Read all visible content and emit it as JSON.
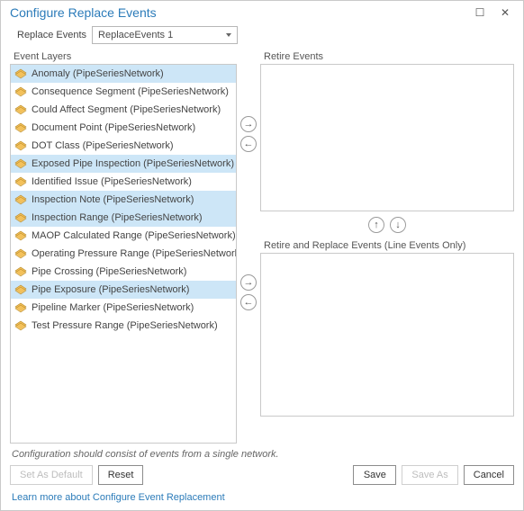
{
  "window": {
    "title": "Configure Replace Events"
  },
  "replaceEvents": {
    "label": "Replace Events",
    "selected": "ReplaceEvents 1"
  },
  "eventLayers": {
    "label": "Event Layers",
    "items": [
      {
        "label": "Anomaly (PipeSeriesNetwork)",
        "selected": true
      },
      {
        "label": "Consequence Segment (PipeSeriesNetwork)",
        "selected": false
      },
      {
        "label": "Could Affect Segment (PipeSeriesNetwork)",
        "selected": false
      },
      {
        "label": "Document Point (PipeSeriesNetwork)",
        "selected": false
      },
      {
        "label": "DOT Class (PipeSeriesNetwork)",
        "selected": false
      },
      {
        "label": "Exposed Pipe Inspection (PipeSeriesNetwork)",
        "selected": true
      },
      {
        "label": "Identified Issue (PipeSeriesNetwork)",
        "selected": false
      },
      {
        "label": "Inspection Note (PipeSeriesNetwork)",
        "selected": true
      },
      {
        "label": "Inspection Range (PipeSeriesNetwork)",
        "selected": true
      },
      {
        "label": "MAOP Calculated Range (PipeSeriesNetwork)",
        "selected": false
      },
      {
        "label": "Operating Pressure Range (PipeSeriesNetwork)",
        "selected": false
      },
      {
        "label": "Pipe Crossing (PipeSeriesNetwork)",
        "selected": false
      },
      {
        "label": "Pipe Exposure (PipeSeriesNetwork)",
        "selected": true
      },
      {
        "label": "Pipeline Marker (PipeSeriesNetwork)",
        "selected": false
      },
      {
        "label": "Test Pressure Range (PipeSeriesNetwork)",
        "selected": false
      }
    ]
  },
  "retireEvents": {
    "label": "Retire Events",
    "items": []
  },
  "retireReplaceEvents": {
    "label": "Retire and Replace Events (Line Events Only)",
    "items": []
  },
  "hint": "Configuration should consist of events from a single network.",
  "buttons": {
    "setDefault": "Set As Default",
    "reset": "Reset",
    "save": "Save",
    "saveAs": "Save As",
    "cancel": "Cancel"
  },
  "link": "Learn more about Configure Event Replacement",
  "icons": {
    "layer": "layer-icon",
    "arrowRight": "→",
    "arrowLeft": "←",
    "arrowUp": "↑",
    "arrowDown": "↓",
    "maximize": "☐",
    "close": "✕"
  }
}
